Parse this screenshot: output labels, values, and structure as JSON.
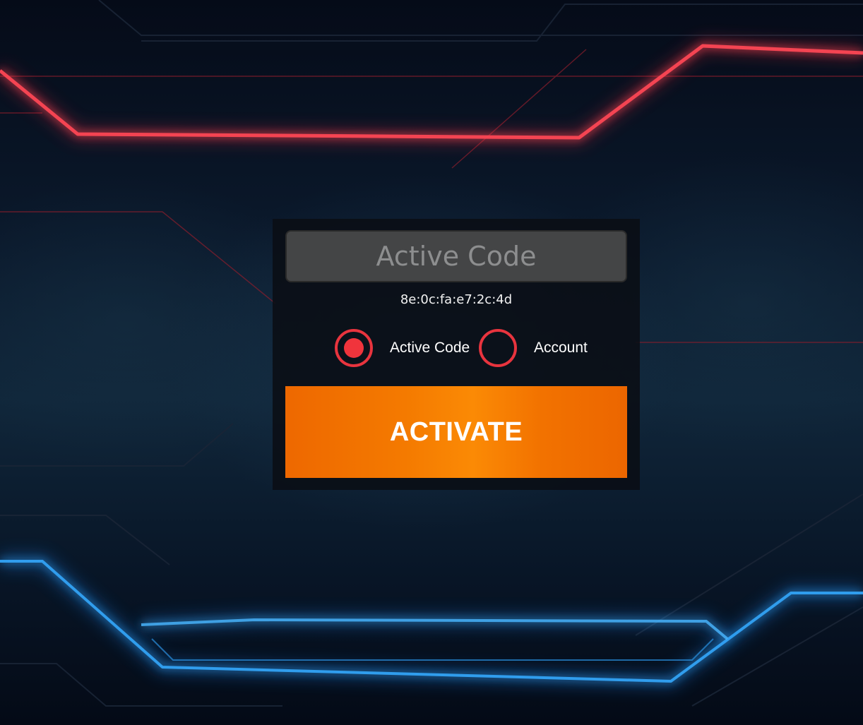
{
  "activation_form": {
    "code_input": {
      "placeholder": "Active Code",
      "value": ""
    },
    "mac_address": "8e:0c:fa:e7:2c:4d",
    "mode_options": [
      {
        "label": "Active Code",
        "selected": true
      },
      {
        "label": "Account",
        "selected": false
      }
    ],
    "activate_label": "ACTIVATE"
  },
  "colors": {
    "accent_red": "#e8343e",
    "activate_orange": "#f47a00",
    "input_background": "#444546",
    "glow_red": "#ff3a4a",
    "glow_blue": "#1aa0ff"
  },
  "icons": {
    "selected_radio": "radio-selected-icon",
    "unselected_radio": "radio-unselected-icon"
  }
}
